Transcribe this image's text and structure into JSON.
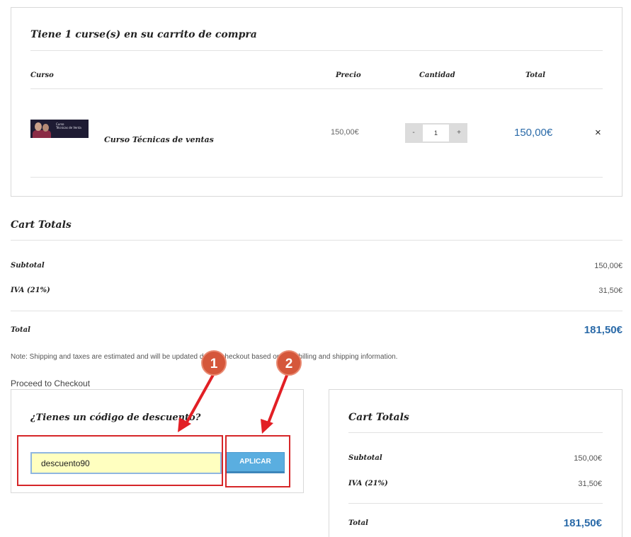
{
  "cart": {
    "title": "Tiene 1 curse(s) en su carrito de compra",
    "columns": {
      "course": "Curso",
      "price": "Precio",
      "quantity": "Cantidad",
      "total": "Total"
    },
    "item": {
      "thumb_text_line1": "Curso",
      "thumb_text_line2": "Técnicas de Venta",
      "name": "Curso Técnicas de ventas",
      "price": "150,00€",
      "qty_minus": "-",
      "qty_value": "1",
      "qty_plus": "+",
      "total": "150,00€",
      "remove": "×"
    }
  },
  "cart_totals": {
    "title": "Cart Totals",
    "subtotal_label": "Subtotal",
    "subtotal_value": "150,00€",
    "vat_label": "IVA (21%)",
    "vat_value": "31,50€",
    "total_label": "Total",
    "total_value": "181,50€"
  },
  "note": "Note: Shipping and taxes are estimated and will be updated during checkout based on your billing and shipping information.",
  "proceed_label": "Proceed to Checkout",
  "coupon": {
    "title": "¿Tienes un código de descuento?",
    "input_value": "descuento90",
    "apply_label": "APLICAR"
  },
  "cart_totals_2": {
    "title": "Cart Totals",
    "subtotal_label": "Subtotal",
    "subtotal_value": "150,00€",
    "vat_label": "IVA (21%)",
    "vat_value": "31,50€",
    "total_label": "Total",
    "total_value": "181,50€"
  },
  "annotations": {
    "badge1": "1",
    "badge2": "2"
  },
  "colors": {
    "accent_blue": "#2a6aa8",
    "highlight_red": "#d62628",
    "badge": "#d5573b"
  }
}
